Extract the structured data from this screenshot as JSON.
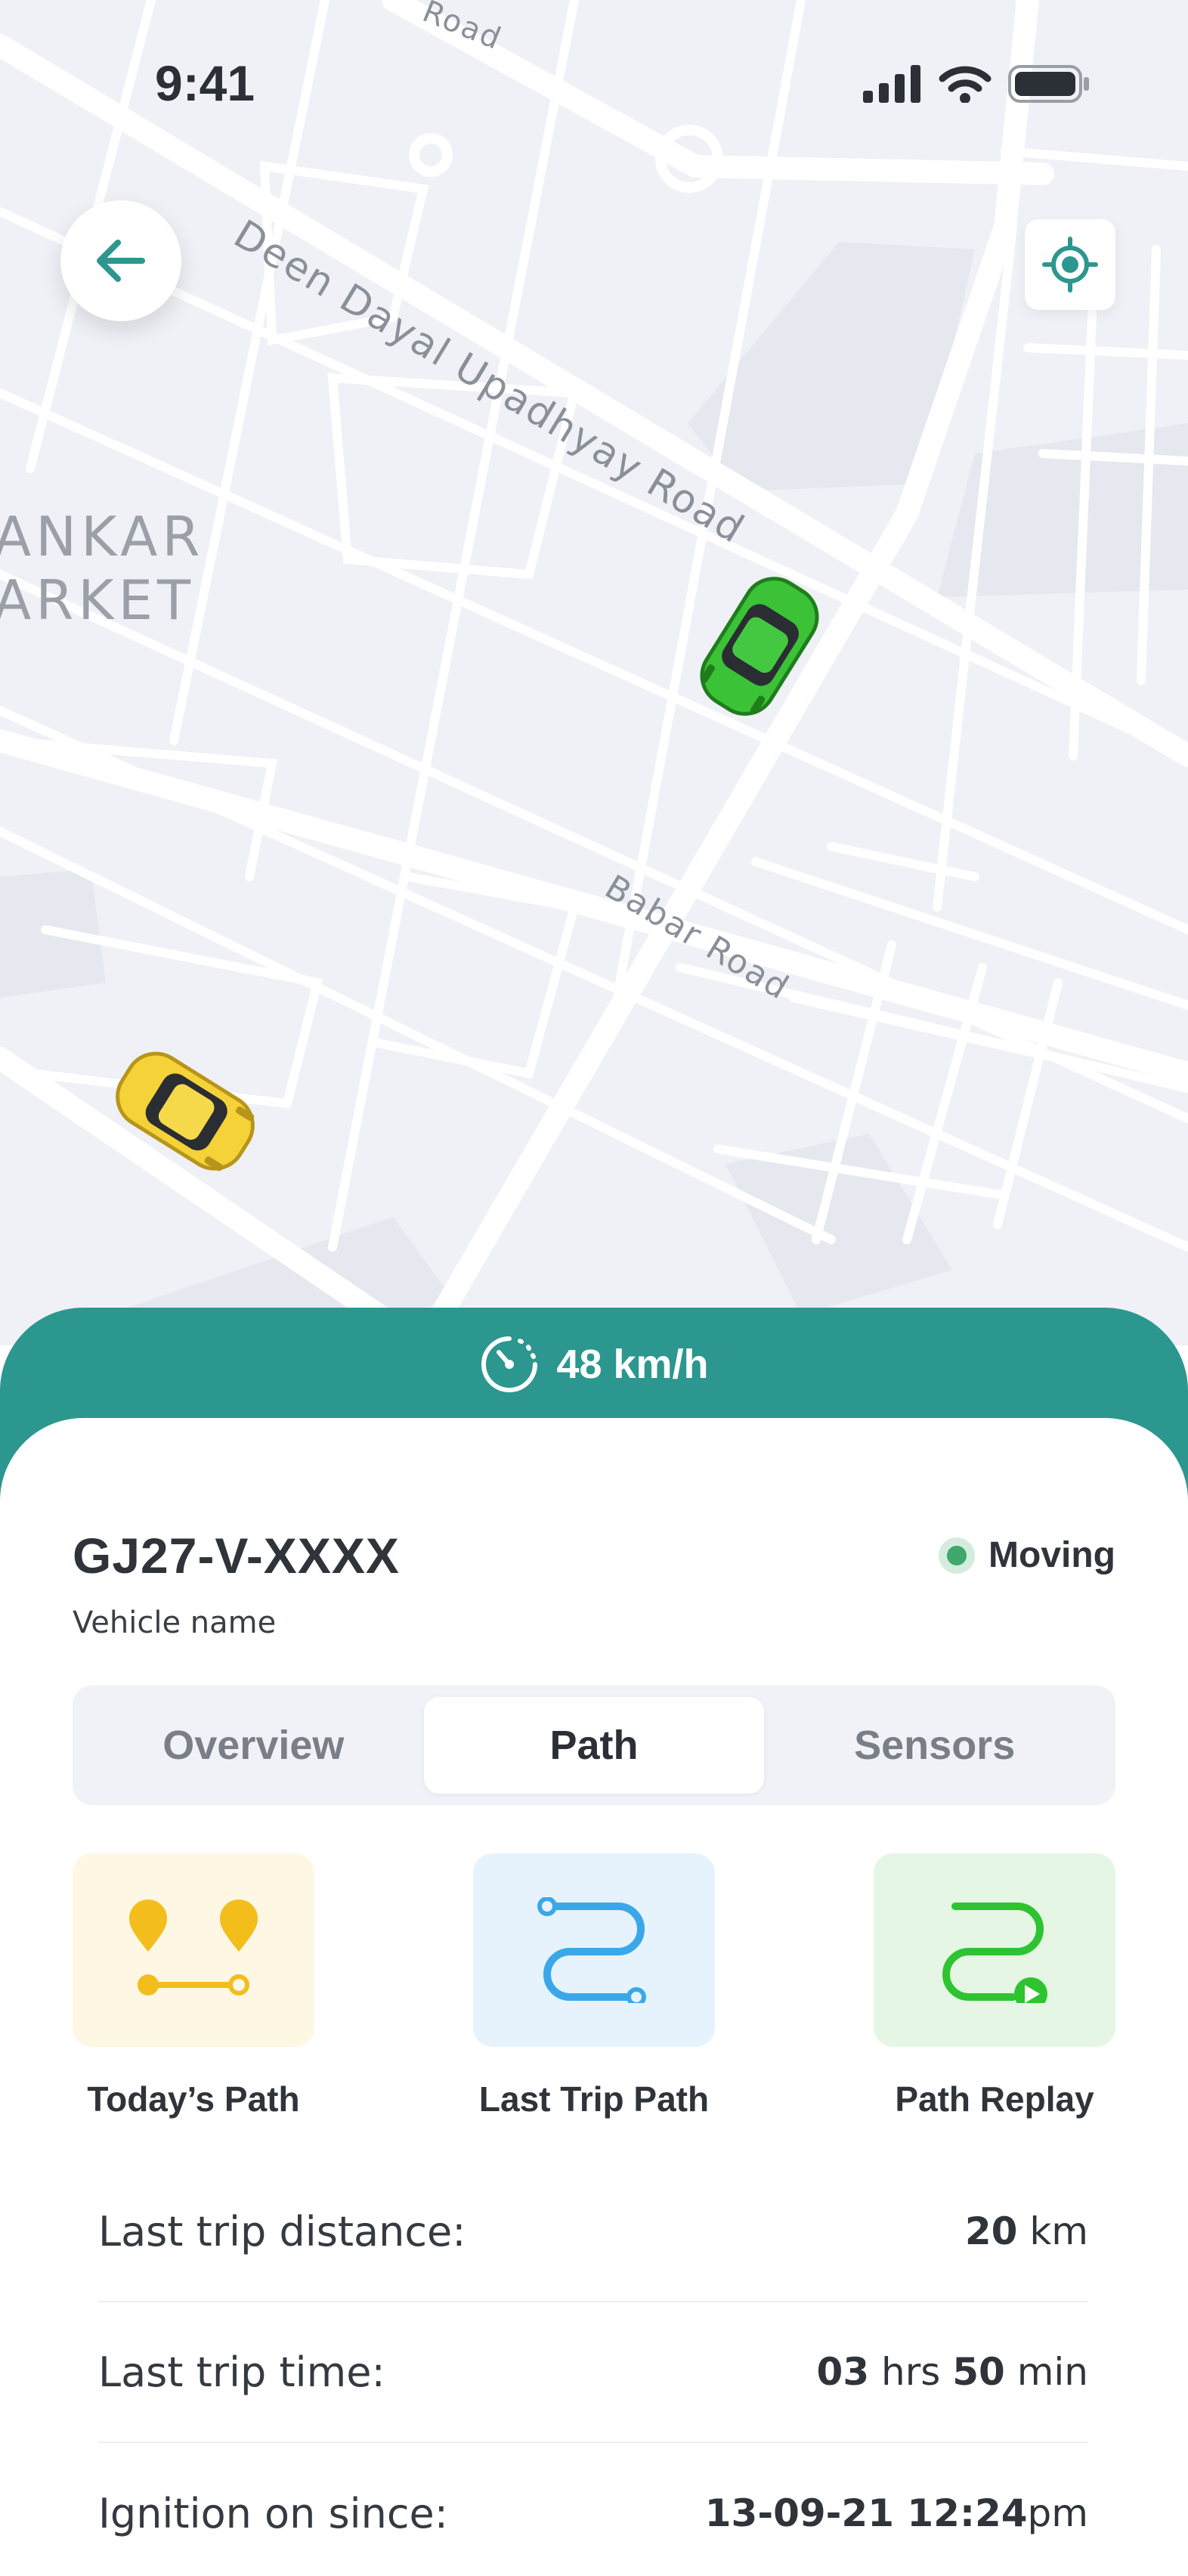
{
  "status_bar": {
    "time": "9:41"
  },
  "map": {
    "road_labels": [
      "Road",
      "Deen Dayal Upadhyay Road",
      "Babar Road"
    ],
    "area_label_lines": [
      "ANKAR",
      "ARKET"
    ]
  },
  "speed": {
    "value": "48 km/h"
  },
  "vehicle": {
    "plate": "GJ27-V-XXXX",
    "name": "Vehicle name",
    "status": "Moving"
  },
  "tabs": [
    {
      "label": "Overview",
      "active": false
    },
    {
      "label": "Path",
      "active": true
    },
    {
      "label": "Sensors",
      "active": false
    }
  ],
  "actions": [
    {
      "label": "Today’s Path",
      "icon": "pin-route-icon"
    },
    {
      "label": "Last Trip Path",
      "icon": "curvy-route-icon"
    },
    {
      "label": "Path Replay",
      "icon": "route-play-icon"
    }
  ],
  "trip_info": [
    {
      "label": "Last trip distance:",
      "parts": [
        [
          "20",
          true
        ],
        [
          " km",
          false
        ]
      ]
    },
    {
      "label": "Last trip time:",
      "parts": [
        [
          "03",
          true
        ],
        [
          " hrs ",
          false
        ],
        [
          "50",
          true
        ],
        [
          " min",
          false
        ]
      ]
    },
    {
      "label": "Ignition on since:",
      "parts": [
        [
          "13-09-21 12:24",
          true
        ],
        [
          "pm",
          false
        ]
      ]
    }
  ],
  "colors": {
    "accent": "#2c978e",
    "status_moving": "#3fa86b",
    "todays_path": "#f3bd1c",
    "last_trip_path": "#3aa8e8",
    "path_replay": "#2ec431"
  }
}
